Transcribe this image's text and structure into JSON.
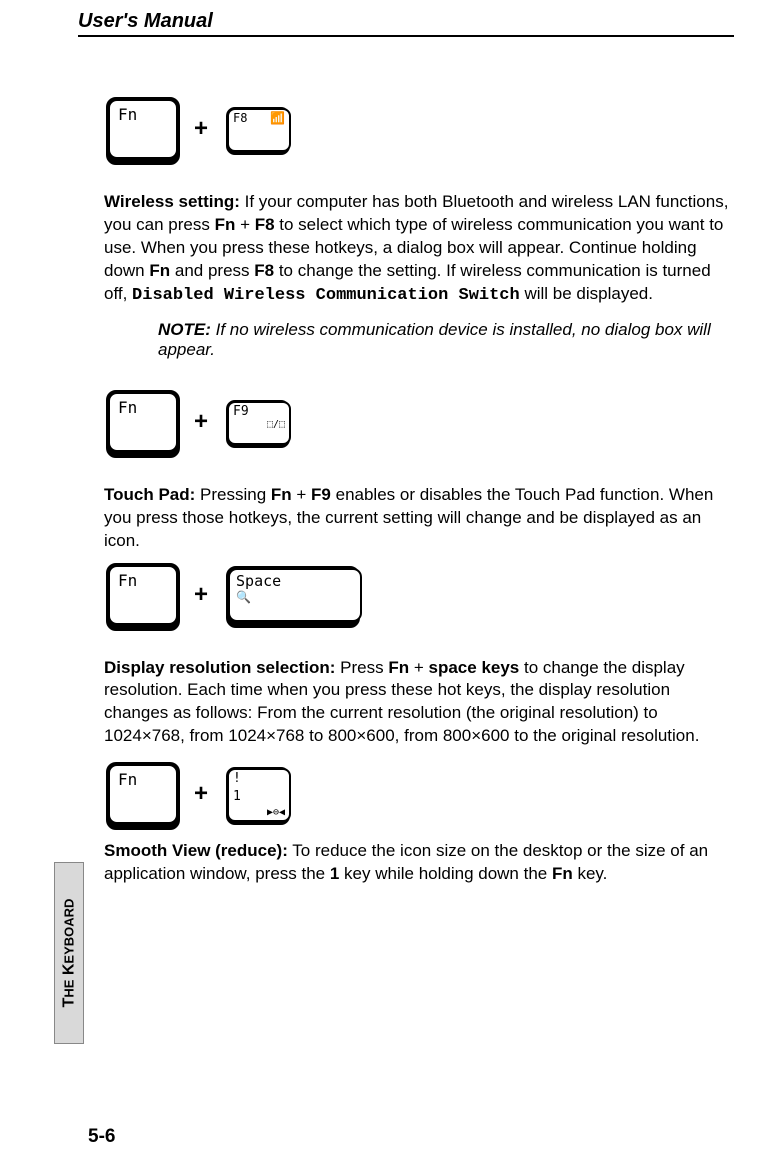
{
  "header": {
    "title": "User's Manual"
  },
  "keys": {
    "fn": "Fn",
    "f8": {
      "label": "F8",
      "sub": "📶"
    },
    "f9": {
      "label": "F9",
      "sub": "⬚/⬚"
    },
    "space": {
      "label": "Space",
      "sub": "🔍"
    },
    "one": {
      "upper": "!",
      "lower": "1",
      "sub": "▶⊖◀"
    }
  },
  "plus": "+",
  "s1": {
    "title": "Wireless setting:",
    "t1": " If your computer has both Bluetooth and wireless LAN functions, you can press ",
    "k1": "Fn",
    "plus": " + ",
    "k2": "F8",
    "t2": " to select which type of wireless communication you want to use. When you press these hotkeys, a dialog box will appear. Continue holding down ",
    "k3": "Fn",
    "t3": " and press ",
    "k4": "F8",
    "t4": " to change the setting. If wireless communication is turned off, ",
    "mono": "Disabled Wireless Communication Switch",
    "t5": " will be displayed."
  },
  "note": {
    "label": "NOTE:",
    "text": " If no wireless communication device is installed, no dialog box will appear."
  },
  "s2": {
    "title": "Touch Pad:",
    "t1": " Pressing ",
    "k1": "Fn",
    "plus": " + ",
    "k2": "F9",
    "t2": " enables or disables the Touch Pad function. When you press those hotkeys, the current setting will change and be displayed as an icon."
  },
  "s3": {
    "title": "Display resolution selection:",
    "t1": " Press ",
    "k1": "Fn",
    "plus": " + ",
    "k2": "space keys",
    "t2": " to change the display resolution. Each time when you press these hot keys, the display resolution changes as follows: From the current resolution (the original resolution) to 1024×768, from 1024×768 to 800×600, from 800×600 to the original resolution."
  },
  "s4": {
    "title": "Smooth View (reduce):",
    "t1": " To reduce the icon size on the desktop or the size of an application window, press the ",
    "k1": "1",
    "t2": " key while holding down the ",
    "k2": "Fn",
    "t3": " key."
  },
  "sidetab": {
    "big1": "T",
    "sm1": "HE",
    "big2": " K",
    "sm2": "EYBOARD"
  },
  "pagenum": "5-6"
}
